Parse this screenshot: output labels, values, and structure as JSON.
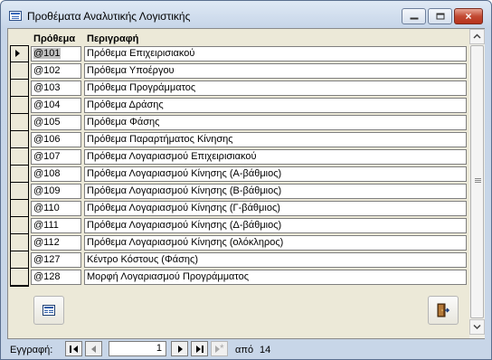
{
  "window": {
    "title": "Προθέματα Αναλυτικής Λογιστικής",
    "minimize_glyph": "minimize-icon",
    "maximize_glyph": "maximize-icon",
    "close_glyph": "×"
  },
  "grid": {
    "columns": [
      "Πρόθεμα",
      "Περιγραφή"
    ],
    "rows": [
      {
        "code": "@101",
        "desc": "Πρόθεμα Επιχειρισιακού"
      },
      {
        "code": "@102",
        "desc": "Πρόθεμα Υποέργου"
      },
      {
        "code": "@103",
        "desc": "Πρόθεμα Προγράμματος"
      },
      {
        "code": "@104",
        "desc": "Πρόθεμα Δράσης"
      },
      {
        "code": "@105",
        "desc": "Πρόθεμα Φάσης"
      },
      {
        "code": "@106",
        "desc": "Πρόθεμα Παραρτήματος Κίνησης"
      },
      {
        "code": "@107",
        "desc": "Πρόθεμα Λογαριασμού Επιχειρισιακού"
      },
      {
        "code": "@108",
        "desc": "Πρόθεμα Λογαριασμού Κίνησης (Α-βάθμιος)"
      },
      {
        "code": "@109",
        "desc": "Πρόθεμα Λογαριασμού Κίνησης (Β-βάθμιος)"
      },
      {
        "code": "@110",
        "desc": "Πρόθεμα Λογαριασμού Κίνησης (Γ-βάθμιος)"
      },
      {
        "code": "@111",
        "desc": "Πρόθεμα Λογαριασμού Κίνησης (Δ-βάθμιος)"
      },
      {
        "code": "@112",
        "desc": "Πρόθεμα Λογαριασμού Κίνησης (ολόκληρος)"
      },
      {
        "code": "@127",
        "desc": "Κέντρο Κόστους (Φάσης)"
      },
      {
        "code": "@128",
        "desc": "Μορφή Λογαριασμού Προγράμματος"
      }
    ],
    "selected_row": 0
  },
  "footer": {
    "form_button_icon": "form-icon",
    "exit_button_icon": "exit-door-icon"
  },
  "navigation": {
    "label": "Εγγραφή:",
    "current": "1",
    "of_label": "από",
    "total": "14"
  }
}
